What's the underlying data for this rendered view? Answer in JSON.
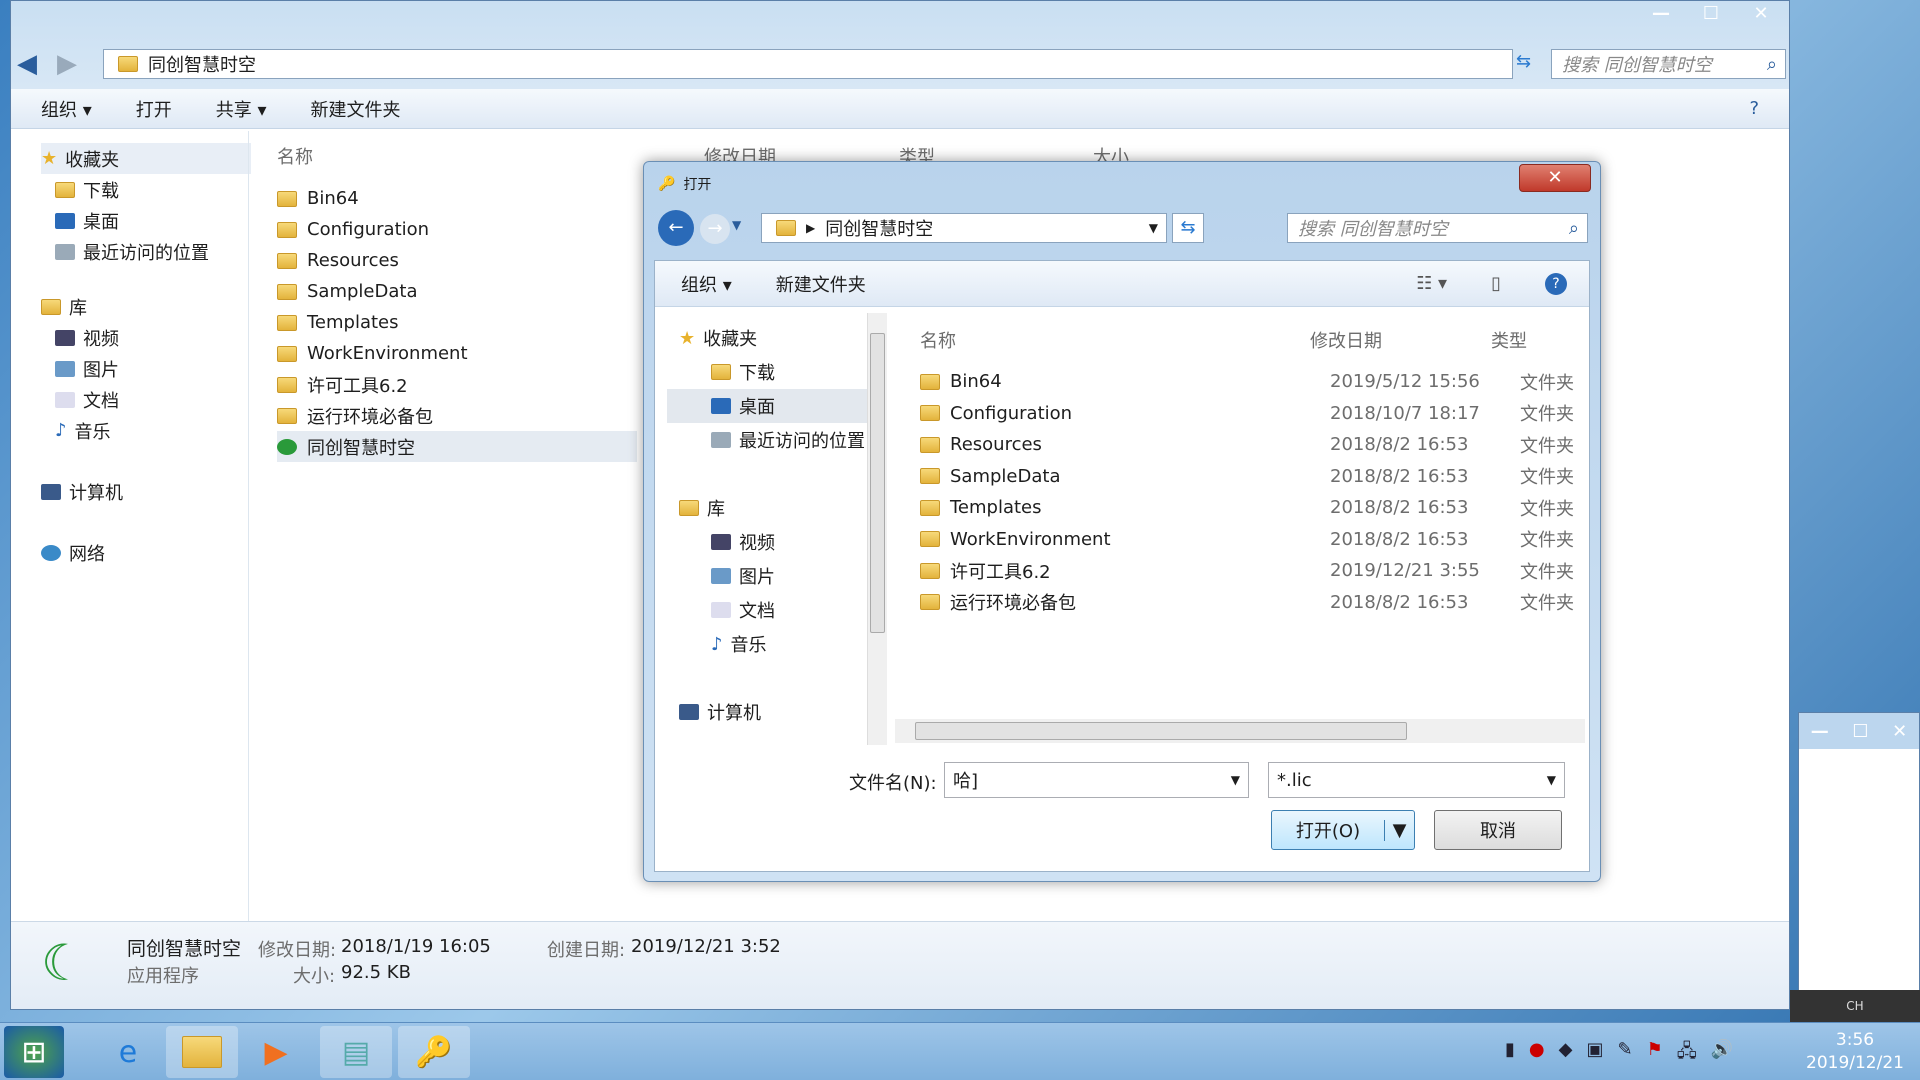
{
  "explorer": {
    "address": "同创智慧时空",
    "search_placeholder": "搜索 同创智慧时空",
    "toolbar": [
      "组织 ▾",
      "打开",
      "共享 ▾",
      "新建文件夹"
    ],
    "nav": {
      "favorites": "收藏夹",
      "fav_items": [
        "下载",
        "桌面",
        "最近访问的位置"
      ],
      "libraries": "库",
      "lib_items": [
        "视频",
        "图片",
        "文档",
        "音乐"
      ],
      "computer": "计算机",
      "network": "网络"
    },
    "columns": [
      "名称",
      "修改日期",
      "类型",
      "大小"
    ],
    "files": [
      "Bin64",
      "Configuration",
      "Resources",
      "SampleData",
      "Templates",
      "WorkEnvironment",
      "许可工具6.2",
      "运行环境必备包",
      "同创智慧时空"
    ],
    "details": {
      "name": "同创智慧时空",
      "type": "应用程序",
      "modified_label": "修改日期:",
      "modified": "2018/1/19 16:05",
      "created_label": "创建日期:",
      "created": "2019/12/21 3:52",
      "size_label": "大小:",
      "size": "92.5 KB"
    }
  },
  "dialog": {
    "title": "打开",
    "address": "同创智慧时空",
    "search_placeholder": "搜索 同创智慧时空",
    "toolbar": {
      "organize": "组织 ▾",
      "new_folder": "新建文件夹"
    },
    "nav": {
      "favorites": "收藏夹",
      "fav_items": [
        "下载",
        "桌面",
        "最近访问的位置"
      ],
      "libraries": "库",
      "lib_items": [
        "视频",
        "图片",
        "文档",
        "音乐"
      ],
      "computer": "计算机"
    },
    "columns": {
      "name": "名称",
      "date": "修改日期",
      "type": "类型"
    },
    "files": [
      {
        "name": "Bin64",
        "date": "2019/5/12 15:56",
        "type": "文件夹"
      },
      {
        "name": "Configuration",
        "date": "2018/10/7 18:17",
        "type": "文件夹"
      },
      {
        "name": "Resources",
        "date": "2018/8/2 16:53",
        "type": "文件夹"
      },
      {
        "name": "SampleData",
        "date": "2018/8/2 16:53",
        "type": "文件夹"
      },
      {
        "name": "Templates",
        "date": "2018/8/2 16:53",
        "type": "文件夹"
      },
      {
        "name": "WorkEnvironment",
        "date": "2018/8/2 16:53",
        "type": "文件夹"
      },
      {
        "name": "许可工具6.2",
        "date": "2019/12/21 3:55",
        "type": "文件夹"
      },
      {
        "name": "运行环境必备包",
        "date": "2018/8/2 16:53",
        "type": "文件夹"
      }
    ],
    "filename_label": "文件名(N):",
    "filename_value": "哈]",
    "filter": "*.lic",
    "open": "打开(O)",
    "cancel": "取消"
  },
  "taskbar": {
    "time": "3:56",
    "date": "2019/12/21",
    "lang": "CH"
  }
}
